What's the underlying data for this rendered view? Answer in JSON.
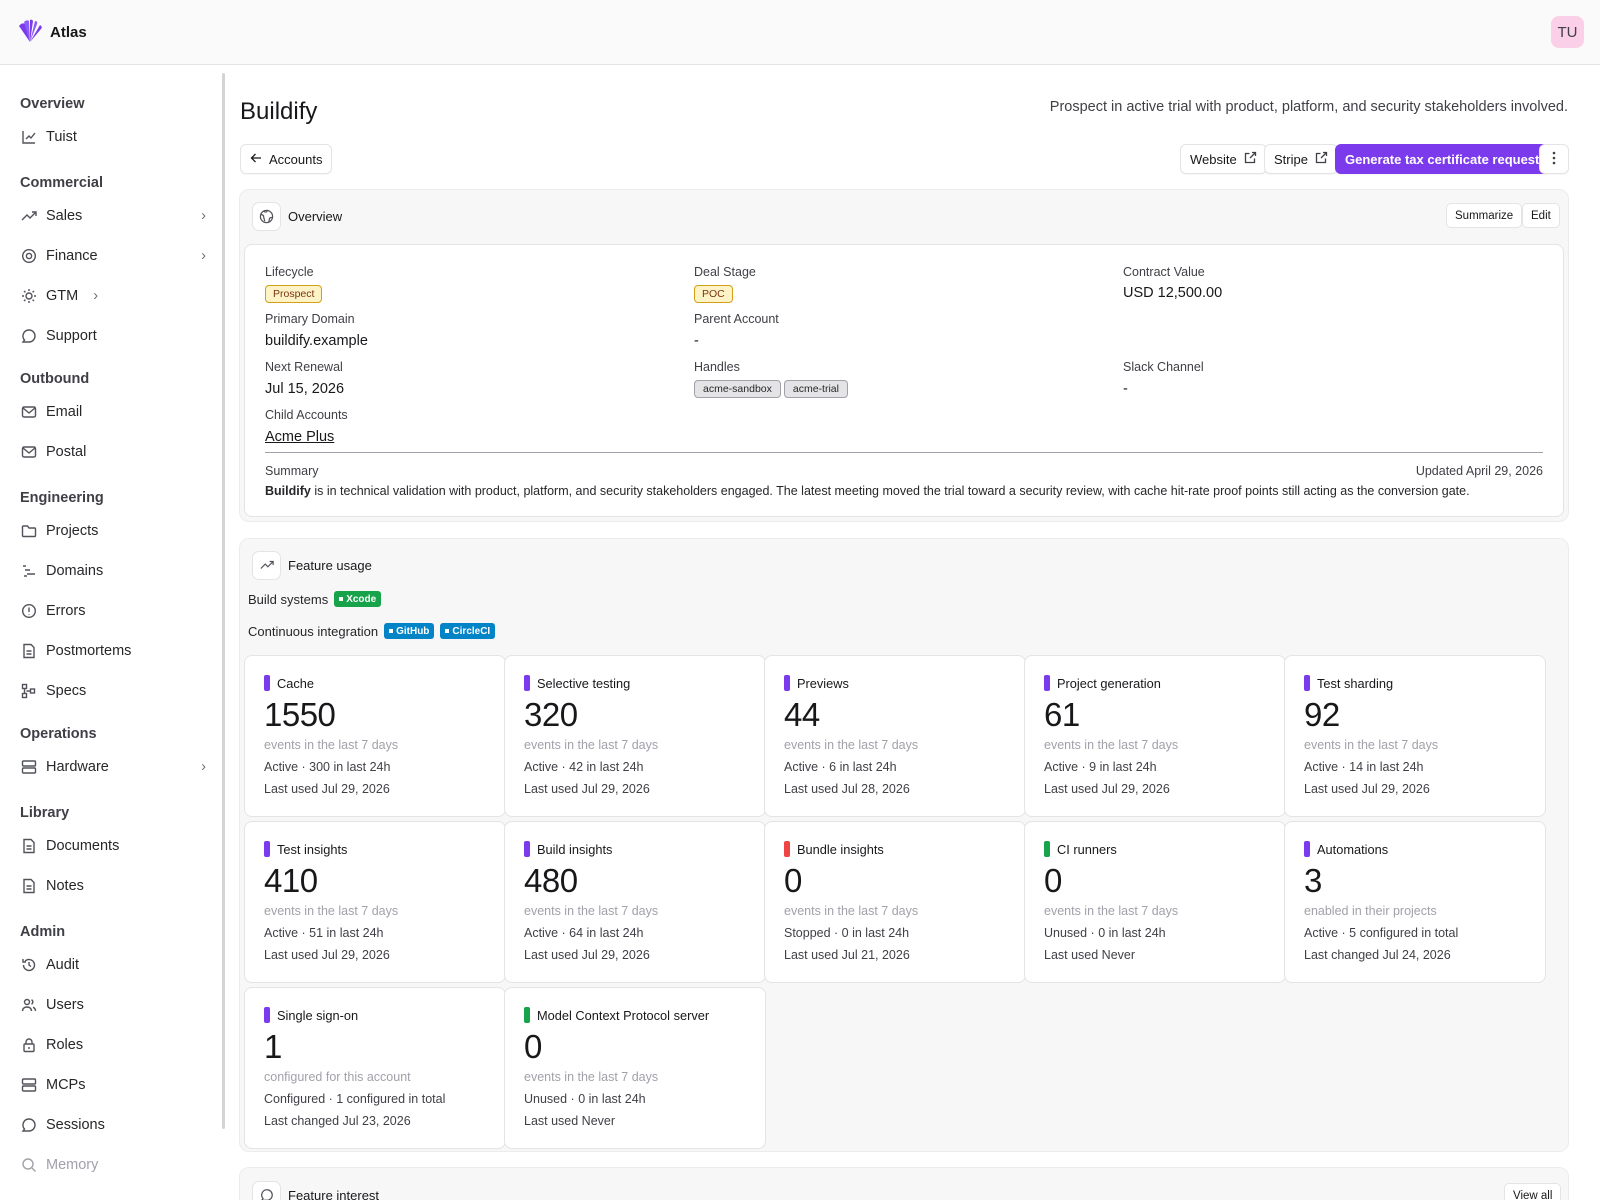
{
  "app": {
    "name": "Atlas",
    "user_initials": "TU"
  },
  "sidebar": {
    "sections": [
      {
        "title": "Overview",
        "items": [
          {
            "label": "Tuist",
            "icon": "chart-icon"
          }
        ]
      },
      {
        "title": "Commercial",
        "items": [
          {
            "label": "Sales",
            "icon": "trending-icon",
            "expandable": true
          },
          {
            "label": "Finance",
            "icon": "coins-icon",
            "expandable": true
          },
          {
            "label": "GTM",
            "icon": "lightbulb-icon",
            "expandable": true
          },
          {
            "label": "Support",
            "icon": "message-icon"
          }
        ]
      },
      {
        "title": "Outbound",
        "items": [
          {
            "label": "Email",
            "icon": "mail-icon"
          },
          {
            "label": "Postal",
            "icon": "envelope-icon"
          }
        ]
      },
      {
        "title": "Engineering",
        "items": [
          {
            "label": "Projects",
            "icon": "folder-icon"
          },
          {
            "label": "Domains",
            "icon": "list-icon"
          },
          {
            "label": "Errors",
            "icon": "alert-icon"
          },
          {
            "label": "Postmortems",
            "icon": "file-icon"
          },
          {
            "label": "Specs",
            "icon": "tree-icon"
          }
        ]
      },
      {
        "title": "Operations",
        "items": [
          {
            "label": "Hardware",
            "icon": "server-icon",
            "expandable": true
          }
        ]
      },
      {
        "title": "Library",
        "items": [
          {
            "label": "Documents",
            "icon": "document-icon"
          },
          {
            "label": "Notes",
            "icon": "note-icon"
          }
        ]
      },
      {
        "title": "Admin",
        "items": [
          {
            "label": "Audit",
            "icon": "history-icon"
          },
          {
            "label": "Users",
            "icon": "users-icon"
          },
          {
            "label": "Roles",
            "icon": "lock-icon"
          },
          {
            "label": "MCPs",
            "icon": "server-icon"
          },
          {
            "label": "Sessions",
            "icon": "message-icon"
          },
          {
            "label": "Memory",
            "icon": "search-icon"
          }
        ]
      }
    ]
  },
  "page": {
    "title": "Buildify",
    "description": "Prospect in active trial with product, platform, and security stakeholders involved.",
    "back_label": "Accounts",
    "actions": {
      "website": "Website",
      "stripe": "Stripe",
      "primary": "Generate tax certificate request"
    }
  },
  "overview": {
    "title": "Overview",
    "summarize_label": "Summarize",
    "edit_label": "Edit",
    "fields": {
      "lifecycle_label": "Lifecycle",
      "lifecycle_value": "Prospect",
      "deal_stage_label": "Deal Stage",
      "deal_stage_value": "POC",
      "contract_value_label": "Contract Value",
      "contract_value": "USD 12,500.00",
      "primary_domain_label": "Primary Domain",
      "primary_domain": "buildify.example",
      "parent_account_label": "Parent Account",
      "parent_account": "-",
      "next_renewal_label": "Next Renewal",
      "next_renewal": "Jul 15, 2026",
      "handles_label": "Handles",
      "handles": [
        "acme-sandbox",
        "acme-trial"
      ],
      "slack_channel_label": "Slack Channel",
      "slack_channel": "-",
      "child_accounts_label": "Child Accounts",
      "child_account": "Acme Plus"
    },
    "summary_label": "Summary",
    "updated": "Updated April 29, 2026",
    "summary_name": "Buildify",
    "summary_text": " is in technical validation with product, platform, and security stakeholders engaged. The latest meeting moved the trial toward a security review, with cache hit-rate proof points still acting as the conversion gate."
  },
  "feature_usage": {
    "title": "Feature usage",
    "build_systems_label": "Build systems",
    "build_systems": [
      {
        "label": "Xcode",
        "color": "#16a34a"
      }
    ],
    "ci_label": "Continuous integration",
    "ci": [
      {
        "label": "GitHub",
        "color": "#0284c7"
      },
      {
        "label": "CircleCI",
        "color": "#0284c7"
      }
    ],
    "cards": [
      {
        "name": "Cache",
        "count": "1550",
        "sub": "events in the last 7 days",
        "status": "Active · 300 in last 24h",
        "last": "Last used Jul 29, 2026",
        "color": "#7c3aed"
      },
      {
        "name": "Selective testing",
        "count": "320",
        "sub": "events in the last 7 days",
        "status": "Active · 42 in last 24h",
        "last": "Last used Jul 29, 2026",
        "color": "#7c3aed"
      },
      {
        "name": "Previews",
        "count": "44",
        "sub": "events in the last 7 days",
        "status": "Active · 6 in last 24h",
        "last": "Last used Jul 28, 2026",
        "color": "#7c3aed"
      },
      {
        "name": "Project generation",
        "count": "61",
        "sub": "events in the last 7 days",
        "status": "Active · 9 in last 24h",
        "last": "Last used Jul 29, 2026",
        "color": "#7c3aed"
      },
      {
        "name": "Test sharding",
        "count": "92",
        "sub": "events in the last 7 days",
        "status": "Active · 14 in last 24h",
        "last": "Last used Jul 29, 2026",
        "color": "#7c3aed"
      },
      {
        "name": "Test insights",
        "count": "410",
        "sub": "events in the last 7 days",
        "status": "Active · 51 in last 24h",
        "last": "Last used Jul 29, 2026",
        "color": "#7c3aed"
      },
      {
        "name": "Build insights",
        "count": "480",
        "sub": "events in the last 7 days",
        "status": "Active · 64 in last 24h",
        "last": "Last used Jul 29, 2026",
        "color": "#7c3aed"
      },
      {
        "name": "Bundle insights",
        "count": "0",
        "sub": "events in the last 7 days",
        "status": "Stopped · 0 in last 24h",
        "last": "Last used Jul 21, 2026",
        "color": "#ef4444"
      },
      {
        "name": "CI runners",
        "count": "0",
        "sub": "events in the last 7 days",
        "status": "Unused · 0 in last 24h",
        "last": "Last used Never",
        "color": "#16a34a"
      },
      {
        "name": "Automations",
        "count": "3",
        "sub": "enabled in their projects",
        "status": "Active · 5 configured in total",
        "last": "Last changed Jul 24, 2026",
        "color": "#7c3aed"
      },
      {
        "name": "Single sign-on",
        "count": "1",
        "sub": "configured for this account",
        "status": "Configured · 1 configured in total",
        "last": "Last changed Jul 23, 2026",
        "color": "#7c3aed"
      },
      {
        "name": "Model Context Protocol server",
        "count": "0",
        "sub": "events in the last 7 days",
        "status": "Unused · 0 in last 24h",
        "last": "Last used Never",
        "color": "#16a34a"
      }
    ]
  },
  "feature_interest": {
    "title": "Feature interest",
    "view_all_label": "View all"
  }
}
